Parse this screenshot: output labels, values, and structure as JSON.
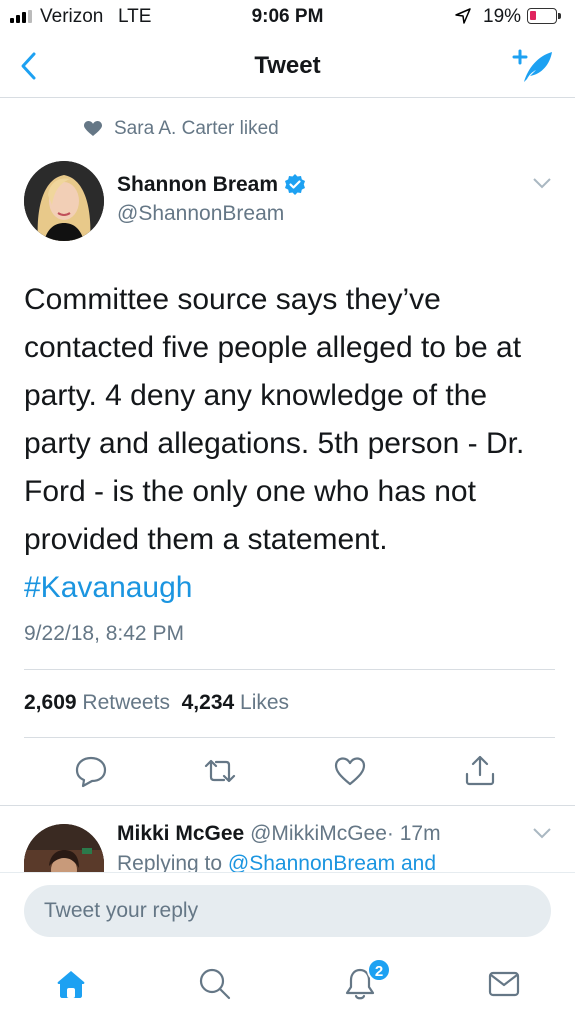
{
  "status_bar": {
    "carrier": "Verizon",
    "network": "LTE",
    "time": "9:06 PM",
    "battery_percent": "19%",
    "battery_level": 0.19,
    "signal_bars": 3,
    "icons": [
      "signal-icon",
      "location-arrow-icon",
      "battery-icon"
    ]
  },
  "nav": {
    "title": "Tweet",
    "back_icon": "chevron-left-icon",
    "compose_icon": "compose-tweet-icon"
  },
  "social_context": {
    "icon": "heart-icon",
    "text": "Sara A. Carter liked"
  },
  "tweet": {
    "author_name": "Shannon Bream",
    "author_handle": "@ShannonBream",
    "verified": true,
    "text_lines": [
      "Committee source says they’ve",
      "contacted five people alleged to be at",
      "party.  4 deny any knowledge of the",
      "party and allegations.  5th person - Dr.",
      "Ford - is the only one who has not",
      "provided them a statement."
    ],
    "hashtag": "#Kavanaugh",
    "timestamp": "9/22/18, 8:42 PM",
    "retweets_count": "2,609",
    "retweets_label": "Retweets",
    "likes_count": "4,234",
    "likes_label": "Likes",
    "actions": [
      "reply-icon",
      "retweet-icon",
      "like-icon",
      "share-icon"
    ]
  },
  "reply_preview": {
    "name": "Mikki McGee",
    "handle": "@MikkiMcGee",
    "time": "· 17m",
    "replying_label": "Replying to",
    "replying_to": "@ShannonBream and"
  },
  "reply_bar": {
    "placeholder": "Tweet your reply"
  },
  "tab_bar": {
    "tabs": [
      "home-icon",
      "search-icon",
      "notifications-icon",
      "messages-icon"
    ],
    "notification_badge": "2"
  },
  "colors": {
    "accent": "#1da1f2",
    "link": "#1b95e0",
    "secondary_text": "#657786",
    "primary_text": "#14171a",
    "battery_low": "#e0245e"
  }
}
